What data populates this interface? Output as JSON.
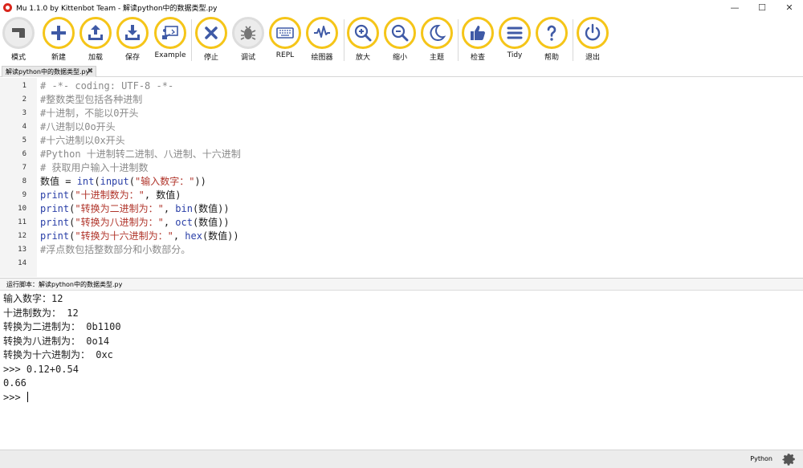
{
  "window": {
    "title": "Mu 1.1.0 by Kittenbot Team - 解读python中的数据类型.py",
    "controls": {
      "minimize": "—",
      "maximize": "☐",
      "close": "✕"
    }
  },
  "toolbar": {
    "buttons": [
      {
        "label": "模式",
        "icon": "mode-icon"
      },
      {
        "label": "新建",
        "icon": "plus-icon"
      },
      {
        "label": "加载",
        "icon": "upload-icon"
      },
      {
        "label": "保存",
        "icon": "download-icon"
      },
      {
        "label": "Example",
        "icon": "example-icon"
      },
      {
        "label": "停止",
        "icon": "stop-icon"
      },
      {
        "label": "调试",
        "icon": "bug-icon"
      },
      {
        "label": "REPL",
        "icon": "keyboard-icon"
      },
      {
        "label": "绘图器",
        "icon": "plotter-icon"
      },
      {
        "label": "放大",
        "icon": "zoom-in-icon"
      },
      {
        "label": "缩小",
        "icon": "zoom-out-icon"
      },
      {
        "label": "主题",
        "icon": "moon-icon"
      },
      {
        "label": "检查",
        "icon": "thumbs-up-icon"
      },
      {
        "label": "Tidy",
        "icon": "tidy-icon"
      },
      {
        "label": "帮助",
        "icon": "help-icon"
      },
      {
        "label": "退出",
        "icon": "power-icon"
      }
    ]
  },
  "tab": {
    "label": "解读python中的数据类型.py",
    "close": "✖"
  },
  "editor": {
    "line_numbers": [
      "1",
      "2",
      "3",
      "4",
      "5",
      "6",
      "7",
      "8",
      "9",
      "10",
      "11",
      "12",
      "13",
      "14"
    ],
    "lines": [
      [
        {
          "t": "# -*- coding: UTF-8 -*-",
          "c": "comment"
        }
      ],
      [
        {
          "t": "#整数类型包括各种进制",
          "c": "comment"
        }
      ],
      [
        {
          "t": "#十进制，不能以0开头",
          "c": "comment"
        }
      ],
      [
        {
          "t": "#八进制以0o开头",
          "c": "comment"
        }
      ],
      [
        {
          "t": "#十六进制以0x开头",
          "c": "comment"
        }
      ],
      [
        {
          "t": "#Python 十进制转二进制、八进制、十六进制",
          "c": "comment"
        }
      ],
      [
        {
          "t": "# 获取用户输入十进制数",
          "c": "comment"
        }
      ],
      [
        {
          "t": "数值 = ",
          "c": "plain"
        },
        {
          "t": "int",
          "c": "kw"
        },
        {
          "t": "(",
          "c": "plain"
        },
        {
          "t": "input",
          "c": "kw"
        },
        {
          "t": "(",
          "c": "plain"
        },
        {
          "t": "\"输入数字：\"",
          "c": "str"
        },
        {
          "t": "))",
          "c": "plain"
        }
      ],
      [
        {
          "t": "print",
          "c": "kw"
        },
        {
          "t": "(",
          "c": "plain"
        },
        {
          "t": "\"十进制数为：\"",
          "c": "str"
        },
        {
          "t": ", 数值)",
          "c": "plain"
        }
      ],
      [
        {
          "t": "print",
          "c": "kw"
        },
        {
          "t": "(",
          "c": "plain"
        },
        {
          "t": "\"转换为二进制为：\"",
          "c": "str"
        },
        {
          "t": ", ",
          "c": "plain"
        },
        {
          "t": "bin",
          "c": "kw"
        },
        {
          "t": "(数值))",
          "c": "plain"
        }
      ],
      [
        {
          "t": "print",
          "c": "kw"
        },
        {
          "t": "(",
          "c": "plain"
        },
        {
          "t": "\"转换为八进制为：\"",
          "c": "str"
        },
        {
          "t": ", ",
          "c": "plain"
        },
        {
          "t": "oct",
          "c": "kw"
        },
        {
          "t": "(数值))",
          "c": "plain"
        }
      ],
      [
        {
          "t": "print",
          "c": "kw"
        },
        {
          "t": "(",
          "c": "plain"
        },
        {
          "t": "\"转换为十六进制为：\"",
          "c": "str"
        },
        {
          "t": ", ",
          "c": "plain"
        },
        {
          "t": "hex",
          "c": "kw"
        },
        {
          "t": "(数值))",
          "c": "plain"
        }
      ],
      [
        {
          "t": "#浮点数包括整数部分和小数部分。",
          "c": "comment"
        }
      ],
      []
    ]
  },
  "repl": {
    "title": "运行脚本：解读python中的数据类型.py",
    "output": [
      "输入数字：12",
      "十进制数为： 12",
      "转换为二进制为： 0b1100",
      "转换为八进制为： 0o14",
      "转换为十六进制为： 0xc",
      ">>> 0.12+0.54",
      "0.66",
      ">>> "
    ]
  },
  "status": {
    "mode": "Python",
    "settings_icon": "gear-icon"
  },
  "colors": {
    "accent": "#f5c518",
    "comment": "#8a8a8a",
    "keyword": "#2a3fa7",
    "string": "#b0342a"
  }
}
